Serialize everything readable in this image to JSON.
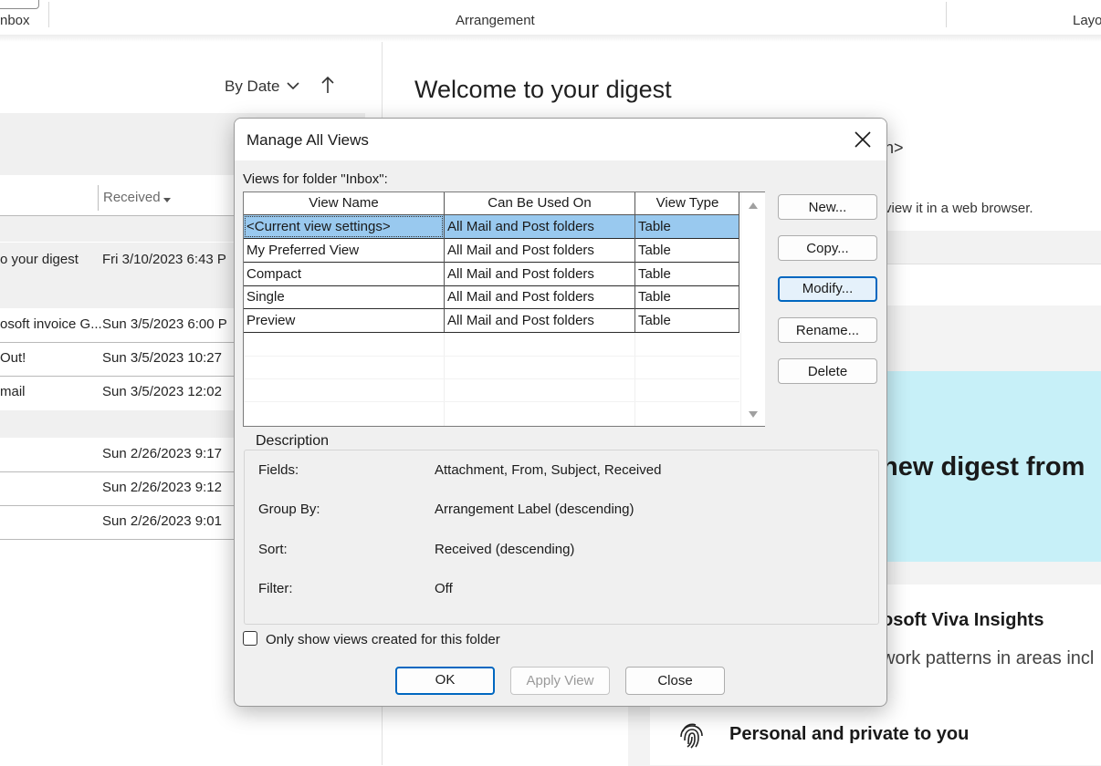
{
  "ribbon": {
    "left_label": "nbox",
    "arrangement_label": "Arrangement",
    "right_label": "Layo"
  },
  "list": {
    "sort_label": "By Date",
    "col_received": "Received",
    "rows": [
      {
        "subject": "o your digest",
        "received": "Fri 3/10/2023 6:43 P"
      },
      {
        "subject": "osoft invoice G...",
        "received": "Sun 3/5/2023 6:00 P"
      },
      {
        "subject": "Out!",
        "received": "Sun 3/5/2023 10:27"
      },
      {
        "subject": "mail",
        "received": "Sun 3/5/2023 12:02"
      },
      {
        "subject": "",
        "received": "Sun 2/26/2023 9:17"
      },
      {
        "subject": "",
        "received": "Sun 2/26/2023 9:12"
      },
      {
        "subject": "",
        "received": "Sun 2/26/2023 9:01"
      }
    ]
  },
  "reading": {
    "title": "Welcome to your digest",
    "fragment1": "n>",
    "web_text": "view it in a web browser.",
    "banner_text": "new digest from",
    "viva_text": "osoft Viva Insights",
    "patterns_text": "work patterns in areas incl",
    "personal_text": "Personal and private to you"
  },
  "dialog": {
    "title": "Manage All Views",
    "folder_label": "Views for folder \"Inbox\":",
    "columns": [
      "View Name",
      "Can Be Used On",
      "View Type"
    ],
    "rows": [
      {
        "name": "<Current view settings>",
        "used_on": "All Mail and Post folders",
        "type": "Table",
        "selected": true
      },
      {
        "name": "My Preferred View",
        "used_on": "All Mail and Post folders",
        "type": "Table"
      },
      {
        "name": "Compact",
        "used_on": "All Mail and Post folders",
        "type": "Table"
      },
      {
        "name": "Single",
        "used_on": "All Mail and Post folders",
        "type": "Table"
      },
      {
        "name": "Preview",
        "used_on": "All Mail and Post folders",
        "type": "Table"
      }
    ],
    "buttons": {
      "new": "New...",
      "copy": "Copy...",
      "modify": "Modify...",
      "rename": "Rename...",
      "delete": "Delete"
    },
    "description": {
      "legend": "Description",
      "fields_label": "Fields:",
      "fields_value": "Attachment, From, Subject, Received",
      "group_label": "Group By:",
      "group_value": "Arrangement Label (descending)",
      "sort_label": "Sort:",
      "sort_value": "Received (descending)",
      "filter_label": "Filter:",
      "filter_value": "Off"
    },
    "checkbox_label": "Only show views created for this folder",
    "checkbox_checked": false,
    "ok": "OK",
    "apply": "Apply View",
    "close": "Close"
  },
  "colors": {
    "selection": "#99c9ef",
    "accent": "#0067c0",
    "banner": "#c7f0f8"
  }
}
